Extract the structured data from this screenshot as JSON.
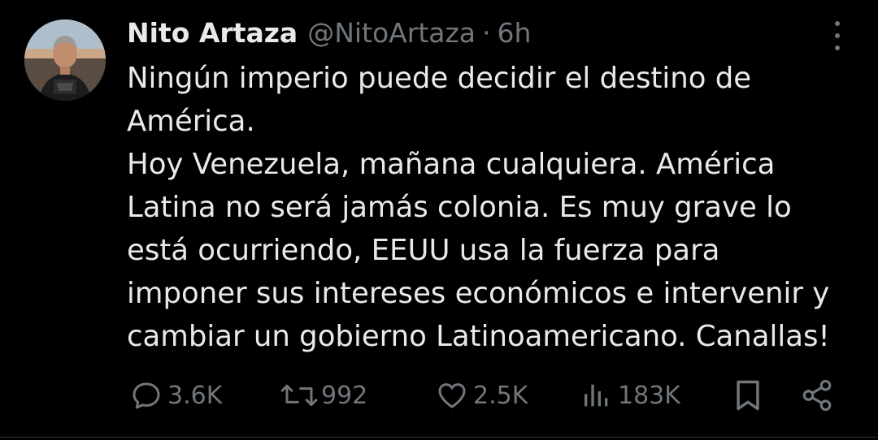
{
  "tweet": {
    "author": {
      "display_name": "Nito Artaza",
      "handle": "@NitoArtaza",
      "separator": "·",
      "time": "6h"
    },
    "text_lines": [
      "Ningún imperio puede decidir el destino de",
      "América.",
      "Hoy Venezuela, mañana cualquiera. América",
      "Latina no será jamás colonia. Es muy grave lo",
      "está ocurriendo, EEUU usa la fuerza para",
      "imponer sus intereses económicos e intervenir y",
      "cambiar un gobierno Latinoamericano. Canallas!"
    ],
    "stats": {
      "replies": "3.6K",
      "reposts": "992",
      "likes": "2.5K",
      "views": "183K"
    },
    "icons": {
      "reply": "reply-icon",
      "repost": "repost-icon",
      "like": "heart-icon",
      "views": "views-icon",
      "bookmark": "bookmark-icon",
      "share": "share-icon",
      "more": "more-icon"
    },
    "colors": {
      "background": "#000000",
      "primary_text": "#e7e9ea",
      "secondary_text": "#71767b"
    }
  }
}
